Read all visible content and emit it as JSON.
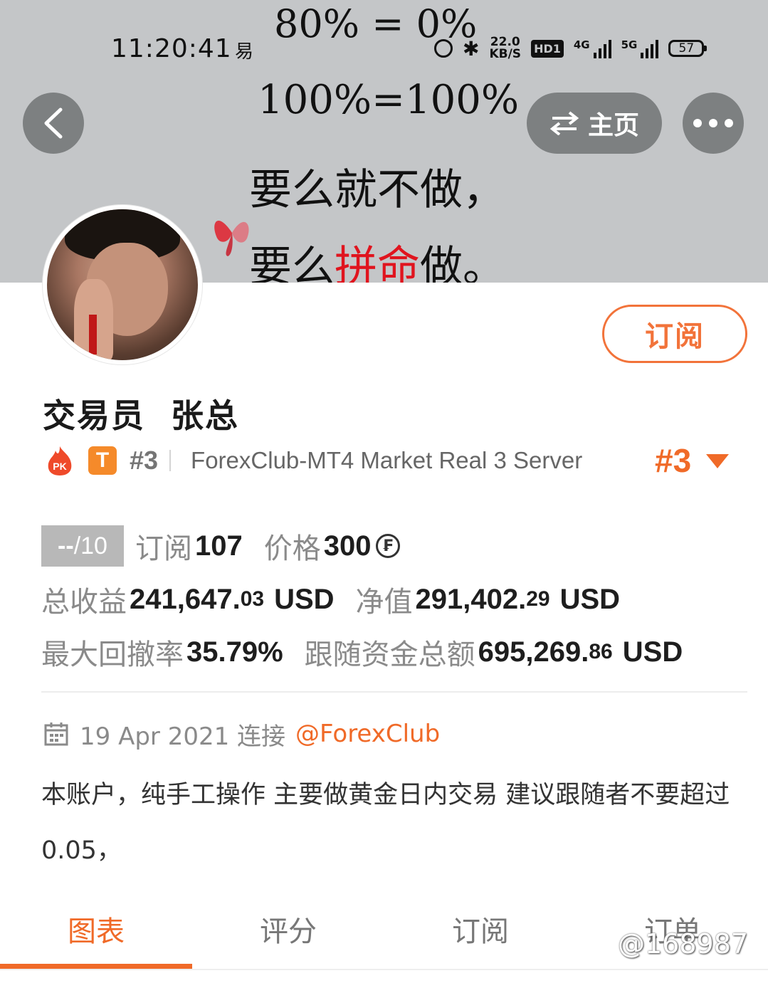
{
  "status_bar": {
    "time": "11:20:41",
    "app_indicator": "易",
    "speed_value": "22.0",
    "speed_unit": "KB/S",
    "hd_label": "HD1",
    "signal1_label": "4G",
    "signal2_label": "5G",
    "battery": "57"
  },
  "banner": {
    "line1": "80% = 0%",
    "line2": "100%=100%",
    "line3": "要么就不做，",
    "line4_a": "要么",
    "line4_b": "拼命",
    "line4_c": "做。"
  },
  "header": {
    "home_label": "主页"
  },
  "profile": {
    "subscribe_label": "订阅",
    "name": "交易员  张总",
    "pk_label": "PK",
    "tier_badge": "T",
    "rank_small": "#3",
    "server": "ForexClub-MT4 Market Real 3 Server",
    "rank_big": "#3"
  },
  "stats": {
    "score_prefix": "--",
    "score_suffix": "/10",
    "subscribe_label": "订阅",
    "subscribe_count": "107",
    "price_label": "价格",
    "price_value": "300",
    "price_currency_symbol": "₣",
    "total_profit_label": "总收益",
    "total_profit_main": "241,647.",
    "total_profit_decimal": "03",
    "total_profit_unit": "USD",
    "equity_label": "净值",
    "equity_main": "291,402.",
    "equity_decimal": "29",
    "equity_unit": "USD",
    "max_drawdown_label": "最大回撤率",
    "max_drawdown_value": "35.79%",
    "follow_funds_label": "跟随资金总额",
    "follow_funds_main": "695,269.",
    "follow_funds_decimal": "86",
    "follow_funds_unit": "USD"
  },
  "connection": {
    "date_text": "19 Apr 2021 连接",
    "broker_link": "@ForexClub"
  },
  "description": "本账户，纯手工操作 主要做黄金日内交易 建议跟随者不要超过 0.05，",
  "tabs": [
    {
      "label": "图表"
    },
    {
      "label": "评分"
    },
    {
      "label": "订阅"
    },
    {
      "label": "订单"
    }
  ],
  "watermark": "@168987",
  "colors": {
    "accent": "#f06a28",
    "banner_bg": "#c4c6c8",
    "badge_orange": "#f58a2a",
    "quote_red": "#e0141e"
  },
  "icons": {
    "back": "chevron-left-icon",
    "switch": "swap-arrows-icon",
    "more": "more-dots-icon",
    "calendar": "calendar-icon",
    "pk": "flame-pk-icon",
    "caret": "caret-down-icon"
  }
}
